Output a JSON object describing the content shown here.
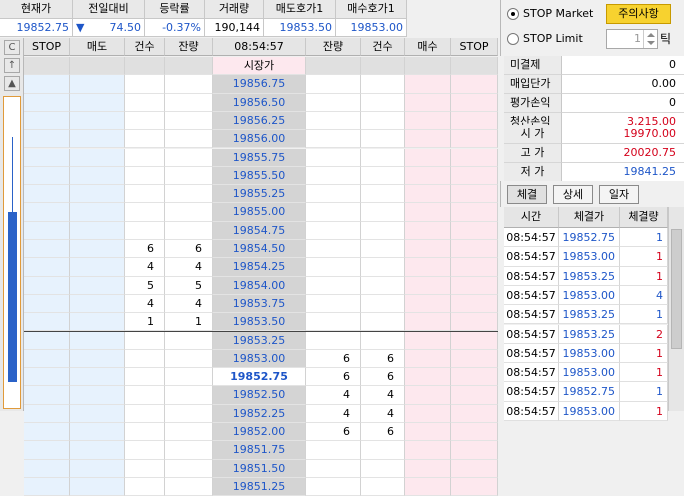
{
  "top_table": {
    "headers": [
      "현재가",
      "전일대비",
      "등락률",
      "거래량",
      "매도호가1",
      "매수호가1"
    ],
    "current_price": "19852.75",
    "change_arrow": "▼",
    "change": "74.50",
    "change_rate": "-0.37%",
    "volume": "190,144",
    "ask1": "19853.50",
    "bid1": "19853.00"
  },
  "order_type": {
    "stop_market_label": "STOP Market",
    "stop_limit_label": "STOP Limit",
    "notice_button": "주의사항",
    "tick_value": "1",
    "tick_label": "틱"
  },
  "left_buttons": {
    "c": "C",
    "up": "↑",
    "up_triangle": "▲"
  },
  "ladder": {
    "headers": [
      "STOP",
      "매도",
      "건수",
      "잔량",
      "08:54:57",
      "잔량",
      "건수",
      "매수",
      "STOP"
    ],
    "market_label": "시장가",
    "rows": [
      {
        "price": "19856.75",
        "lc": "",
        "lv": "",
        "rv": "",
        "rc": ""
      },
      {
        "price": "19856.50",
        "lc": "",
        "lv": "",
        "rv": "",
        "rc": ""
      },
      {
        "price": "19856.25",
        "lc": "",
        "lv": "",
        "rv": "",
        "rc": ""
      },
      {
        "price": "19856.00",
        "lc": "",
        "lv": "",
        "rv": "",
        "rc": ""
      },
      {
        "price": "19855.75",
        "lc": "",
        "lv": "",
        "rv": "",
        "rc": ""
      },
      {
        "price": "19855.50",
        "lc": "",
        "lv": "",
        "rv": "",
        "rc": ""
      },
      {
        "price": "19855.25",
        "lc": "",
        "lv": "",
        "rv": "",
        "rc": ""
      },
      {
        "price": "19855.00",
        "lc": "",
        "lv": "",
        "rv": "",
        "rc": ""
      },
      {
        "price": "19854.75",
        "lc": "",
        "lv": "",
        "rv": "",
        "rc": ""
      },
      {
        "price": "19854.50",
        "lc": "6",
        "lv": "6",
        "rv": "",
        "rc": ""
      },
      {
        "price": "19854.25",
        "lc": "4",
        "lv": "4",
        "rv": "",
        "rc": ""
      },
      {
        "price": "19854.00",
        "lc": "5",
        "lv": "5",
        "rv": "",
        "rc": ""
      },
      {
        "price": "19853.75",
        "lc": "4",
        "lv": "4",
        "rv": "",
        "rc": ""
      },
      {
        "price": "19853.50",
        "lc": "1",
        "lv": "1",
        "rv": "",
        "rc": ""
      },
      {
        "price": "19853.25",
        "lc": "",
        "lv": "",
        "rv": "",
        "rc": ""
      },
      {
        "price": "19853.00",
        "lc": "",
        "lv": "",
        "rv": "6",
        "rc": "6"
      },
      {
        "price": "19852.75",
        "lc": "",
        "lv": "",
        "rv": "6",
        "rc": "6",
        "current": true
      },
      {
        "price": "19852.50",
        "lc": "",
        "lv": "",
        "rv": "4",
        "rc": "4"
      },
      {
        "price": "19852.25",
        "lc": "",
        "lv": "",
        "rv": "4",
        "rc": "4"
      },
      {
        "price": "19852.00",
        "lc": "",
        "lv": "",
        "rv": "6",
        "rc": "6"
      },
      {
        "price": "19851.75",
        "lc": "",
        "lv": "",
        "rv": "",
        "rc": ""
      },
      {
        "price": "19851.50",
        "lc": "",
        "lv": "",
        "rv": "",
        "rc": ""
      },
      {
        "price": "19851.25",
        "lc": "",
        "lv": "",
        "rv": "",
        "rc": ""
      }
    ]
  },
  "account": {
    "rows": [
      {
        "label": "미결제",
        "value": "0",
        "color": "#000000"
      },
      {
        "label": "매입단가",
        "value": "0.00",
        "color": "#000000"
      },
      {
        "label": "평가손익",
        "value": "0",
        "color": "#000000"
      },
      {
        "label": "청산손익",
        "value": "3,215.00",
        "color": "#d4001a"
      }
    ]
  },
  "quote": {
    "rows": [
      {
        "label": "시 가",
        "value": "19970.00",
        "color": "#d4001a"
      },
      {
        "label": "고 가",
        "value": "20020.75",
        "color": "#d4001a"
      },
      {
        "label": "저 가",
        "value": "19841.25",
        "color": "#1e56c8"
      }
    ]
  },
  "tabs": [
    "체결",
    "상세",
    "일자"
  ],
  "executions": {
    "headers": [
      "시간",
      "체결가",
      "체결량"
    ],
    "rows": [
      {
        "time": "08:54:57",
        "price": "19852.75",
        "qty": "1",
        "qty_color": "#1e56c8"
      },
      {
        "time": "08:54:57",
        "price": "19853.00",
        "qty": "1",
        "qty_color": "#d4001a"
      },
      {
        "time": "08:54:57",
        "price": "19853.25",
        "qty": "1",
        "qty_color": "#d4001a"
      },
      {
        "time": "08:54:57",
        "price": "19853.00",
        "qty": "4",
        "qty_color": "#1e56c8"
      },
      {
        "time": "08:54:57",
        "price": "19853.25",
        "qty": "1",
        "qty_color": "#1e56c8"
      },
      {
        "time": "08:54:57",
        "price": "19853.25",
        "qty": "2",
        "qty_color": "#d4001a"
      },
      {
        "time": "08:54:57",
        "price": "19853.00",
        "qty": "1",
        "qty_color": "#d4001a"
      },
      {
        "time": "08:54:57",
        "price": "19853.00",
        "qty": "1",
        "qty_color": "#d4001a"
      },
      {
        "time": "08:54:57",
        "price": "19852.75",
        "qty": "1",
        "qty_color": "#1e56c8"
      },
      {
        "time": "08:54:57",
        "price": "19853.00",
        "qty": "1",
        "qty_color": "#d4001a"
      }
    ]
  },
  "colors": {
    "blue": "#1e56c8",
    "red": "#d4001a",
    "notice_button_bg": "#f7d22f",
    "bid_bg": "#e7f2fd",
    "ask_bg": "#fde8ee",
    "price_bg": "#d4d4d4"
  }
}
